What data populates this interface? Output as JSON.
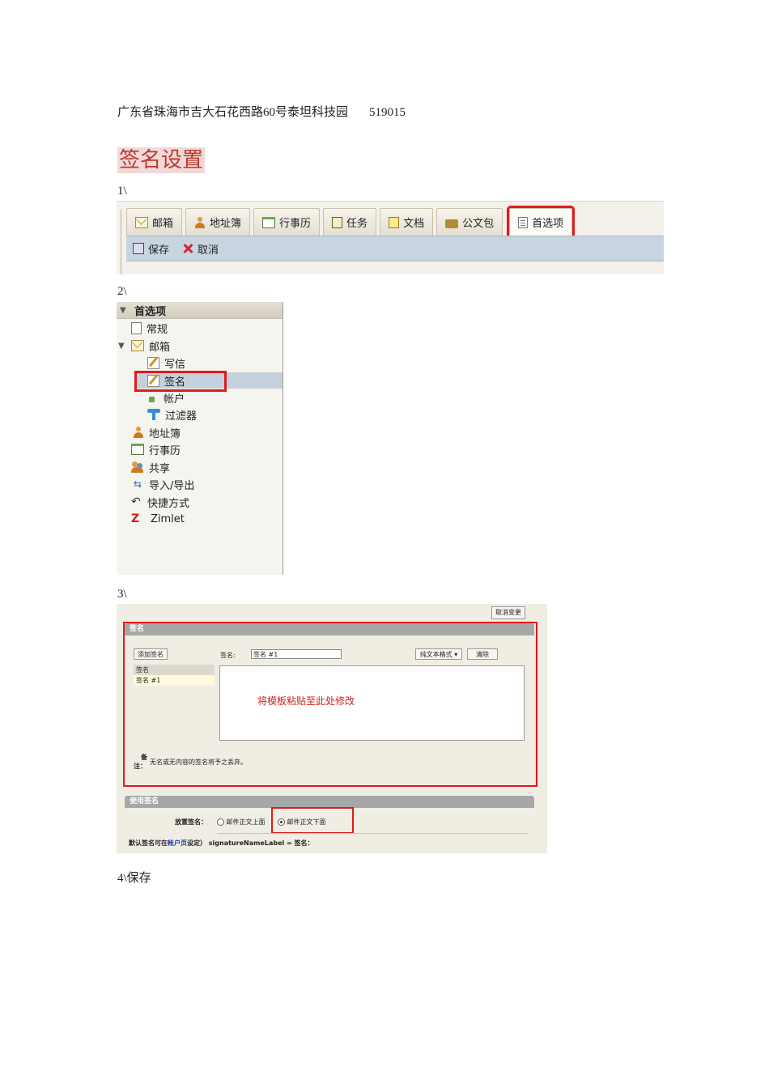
{
  "address": {
    "text": "广东省珠海市吉大石花西路60号泰坦科技园",
    "zip": "519015"
  },
  "title": "签名设置",
  "steps": {
    "s1": "1\\",
    "s2": "2\\",
    "s3": "3\\",
    "s4": "4\\保存"
  },
  "toolbar": {
    "tabs": [
      {
        "label": "邮箱",
        "icon": "mail-icon"
      },
      {
        "label": "地址簿",
        "icon": "person-icon"
      },
      {
        "label": "行事历",
        "icon": "calendar-icon"
      },
      {
        "label": "任务",
        "icon": "task-icon"
      },
      {
        "label": "文档",
        "icon": "document-icon"
      },
      {
        "label": "公文包",
        "icon": "briefcase-icon"
      },
      {
        "label": "首选项",
        "icon": "preferences-icon",
        "active": true
      }
    ],
    "save_label": "保存",
    "cancel_label": "取消"
  },
  "tree": {
    "header": "首选项",
    "items": [
      "常规",
      "邮箱",
      "写信",
      "签名",
      "帐户",
      "过滤器",
      "地址簿",
      "行事历",
      "共享",
      "导入/导出",
      "快捷方式",
      "Zimlet"
    ]
  },
  "signature": {
    "cancel_changes": "取消变更",
    "panel_title": "签名",
    "add_button": "添加签名",
    "name_label": "签名:",
    "name_value": "签名 #1",
    "format": "纯文本格式",
    "clear_button": "清除",
    "list_header": "签名",
    "list_item": "签名 #1",
    "editor_hint": "将模板粘贴至此处修改",
    "note_label_1": "备",
    "note_label_2": "注：",
    "note_text": "无名或无内容的签名将予之丢弃。",
    "use_title": "使用签名",
    "placement_label": "放置签名：",
    "option_above": "邮件正文上面",
    "option_below": "邮件正文下面",
    "footer_prefix": "默认签名可在",
    "footer_link": "帐户页",
    "footer_suffix": "设定） signatureNameLabel = 签名："
  }
}
